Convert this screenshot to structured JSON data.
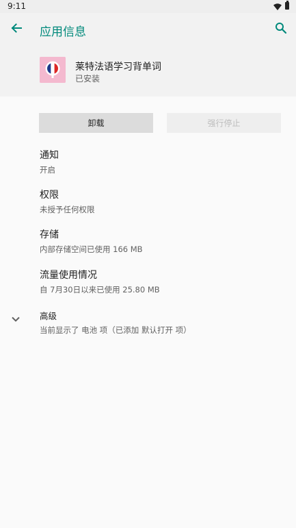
{
  "status_bar": {
    "time": "9:11"
  },
  "app_bar": {
    "title": "应用信息"
  },
  "app": {
    "name": "莱特法语学习背单词",
    "status": "已安装"
  },
  "actions": {
    "uninstall": "卸载",
    "force_stop": "强行停止"
  },
  "prefs": {
    "notifications": {
      "title": "通知",
      "summary": "开启"
    },
    "permissions": {
      "title": "权限",
      "summary": "未授予任何权限"
    },
    "storage": {
      "title": "存储",
      "summary": "内部存储空间已使用 166 MB"
    },
    "data_usage": {
      "title": "流量使用情况",
      "summary": "自 7月30日以来已使用 25.80 MB"
    },
    "advanced": {
      "title": "高级",
      "summary": "当前显示了 电池 项（已添加 默认打开 项）"
    }
  },
  "colors": {
    "accent": "#00897b",
    "icon_bg": "#f4b9cf"
  }
}
